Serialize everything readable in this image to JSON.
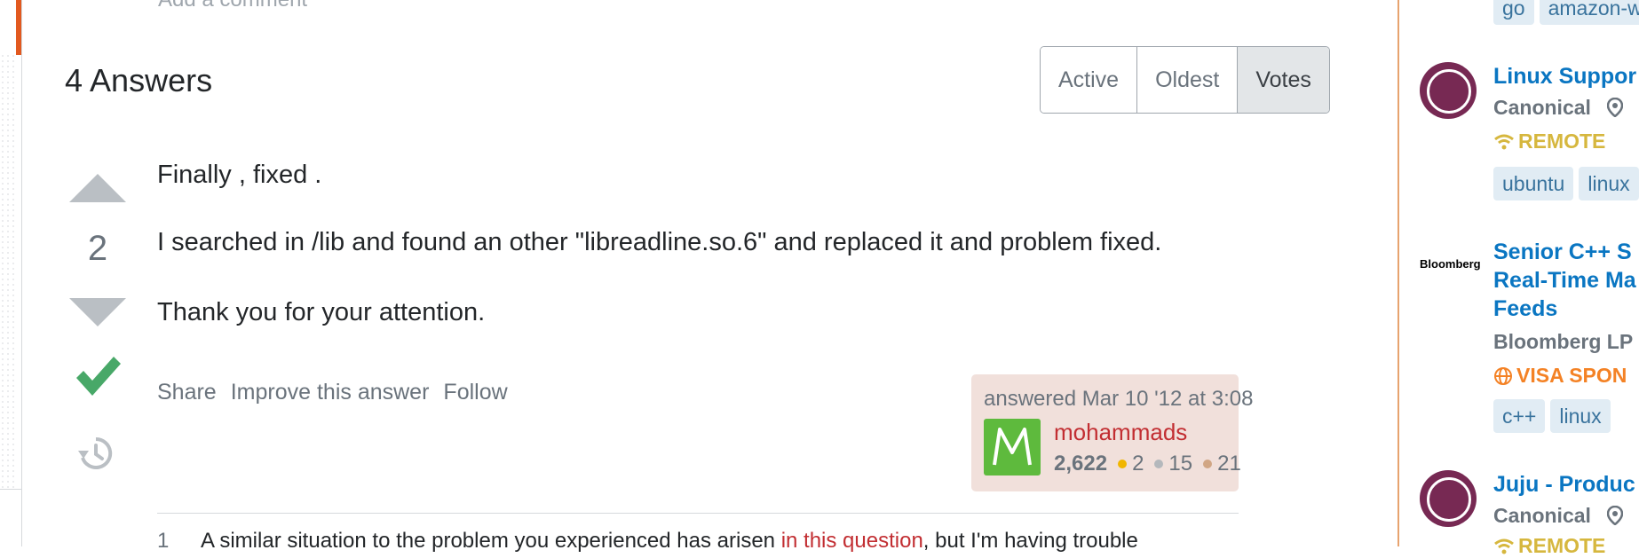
{
  "comment_link": "Add a comment",
  "answers": {
    "count_label": "4 Answers"
  },
  "sort_tabs": [
    {
      "label": "Active",
      "active": false
    },
    {
      "label": "Oldest",
      "active": false
    },
    {
      "label": "Votes",
      "active": true
    }
  ],
  "answer": {
    "vote_count": "2",
    "paragraphs": [
      "Finally , fixed .",
      "I searched in /lib and found an other \"libreadline.so.6\" and replaced it and problem fixed.",
      "Thank you for your attention."
    ],
    "menu": {
      "share": "Share",
      "improve": "Improve this answer",
      "follow": "Follow"
    },
    "user_card": {
      "action": "answered Mar 10 '12 at 3:08",
      "avatar_letter": "M",
      "name": "mohammads",
      "reputation": "2,622",
      "gold": "2",
      "silver": "15",
      "bronze": "21"
    }
  },
  "comment": {
    "score": "1",
    "text_before": "A similar situation to the problem you experienced has arisen",
    "link_text": "in this question",
    "text_after": ", but I'm having trouble"
  },
  "sidebar": {
    "top_tags": [
      "go",
      "amazon-w"
    ],
    "jobs": [
      {
        "title_lines": [
          "Linux Suppor"
        ],
        "company": "Canonical",
        "tagline": "REMOTE",
        "tagline_icon": "wifi-icon",
        "tags": [
          "ubuntu",
          "linux"
        ]
      },
      {
        "logo_text": "Bloomberg",
        "title_lines": [
          "Senior C++ S",
          "Real-Time Ma",
          "Feeds"
        ],
        "company": "Bloomberg LP",
        "tagline": "VISA SPON",
        "tagline_icon": "globe-icon",
        "tags": [
          "c++",
          "linux"
        ]
      },
      {
        "title_lines": [
          "Juju - Produc"
        ],
        "company": "Canonical",
        "tagline": "REMOTE",
        "tagline_icon": "wifi-icon",
        "tags": []
      }
    ]
  },
  "colors": {
    "accent_red": "#c22e32",
    "accepted_green": "#48a868",
    "link_blue": "#0a76c2",
    "remote_yellow": "#d6b73e",
    "visa_orange": "#f48225"
  }
}
